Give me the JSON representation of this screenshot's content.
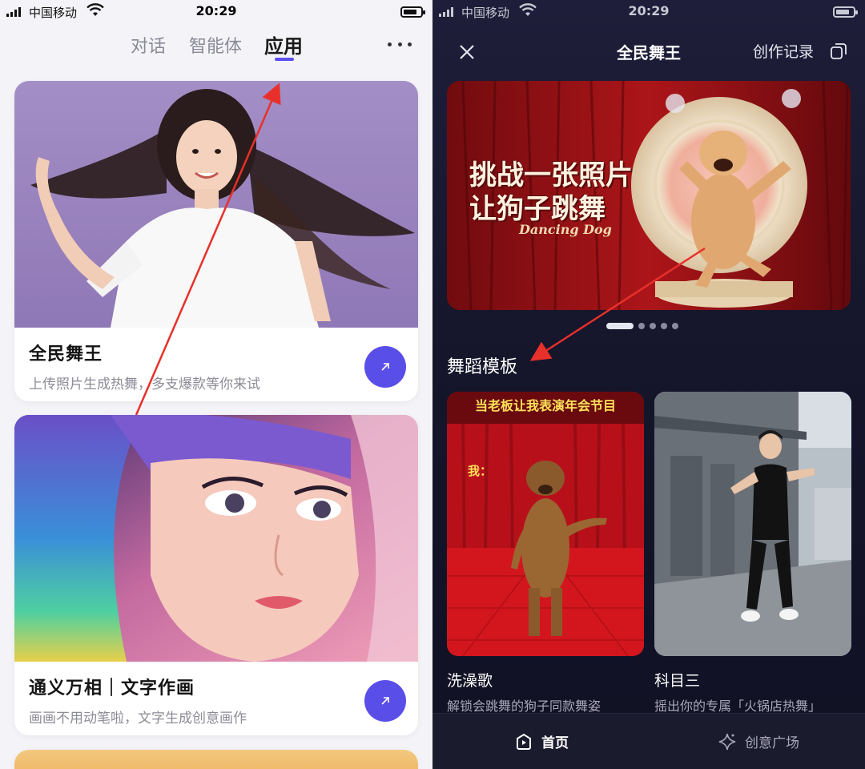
{
  "left": {
    "status": {
      "carrier": "中国移动",
      "time": "20:29"
    },
    "tabs": [
      {
        "label": "对话"
      },
      {
        "label": "智能体"
      },
      {
        "label": "应用"
      }
    ],
    "cards": [
      {
        "title": "全民舞王",
        "desc": "上传照片生成热舞，多支爆款等你来试"
      },
      {
        "title": "通义万相｜文字作画",
        "desc": "画画不用动笔啦，文字生成创意画作"
      }
    ]
  },
  "right": {
    "status": {
      "carrier": "中国移动",
      "time": "20:29"
    },
    "header": {
      "title": "全民舞王",
      "record": "创作记录"
    },
    "banner": {
      "line1": "挑战一张照片",
      "line2": "让狗子跳舞",
      "line3": "Dancing Dog"
    },
    "section_title": "舞蹈模板",
    "templates": [
      {
        "name": "洗澡歌",
        "desc": "解锁会跳舞的狗子同款舞姿",
        "caption": "当老板让我表演年会节目",
        "caption2": "我："
      },
      {
        "name": "科目三",
        "desc": "摇出你的专属「火锅店热舞」"
      }
    ],
    "nav": {
      "home": "首页",
      "square": "创意广场"
    }
  },
  "colors": {
    "accent": "#5a4ee8",
    "annotation": "#e8302a"
  }
}
